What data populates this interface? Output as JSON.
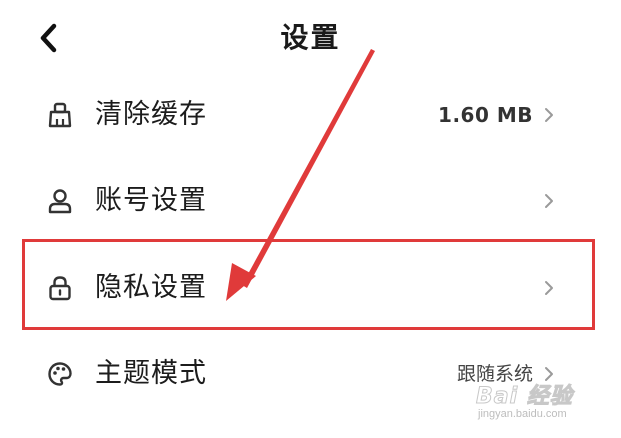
{
  "header": {
    "title": "设置",
    "back_icon": "chevron-left-icon"
  },
  "settings": {
    "items": [
      {
        "label": "清除缓存",
        "value": "1.60 MB",
        "icon": "broom-icon"
      },
      {
        "label": "账号设置",
        "value": "",
        "icon": "user-icon"
      },
      {
        "label": "隐私设置",
        "value": "",
        "icon": "lock-icon"
      },
      {
        "label": "主题模式",
        "value": "跟随系统",
        "icon": "palette-icon"
      }
    ]
  },
  "annotation": {
    "highlight_color": "#e03a3a"
  },
  "watermark": {
    "brand": "Bai 经验",
    "url": "jingyan.baidu.com"
  }
}
